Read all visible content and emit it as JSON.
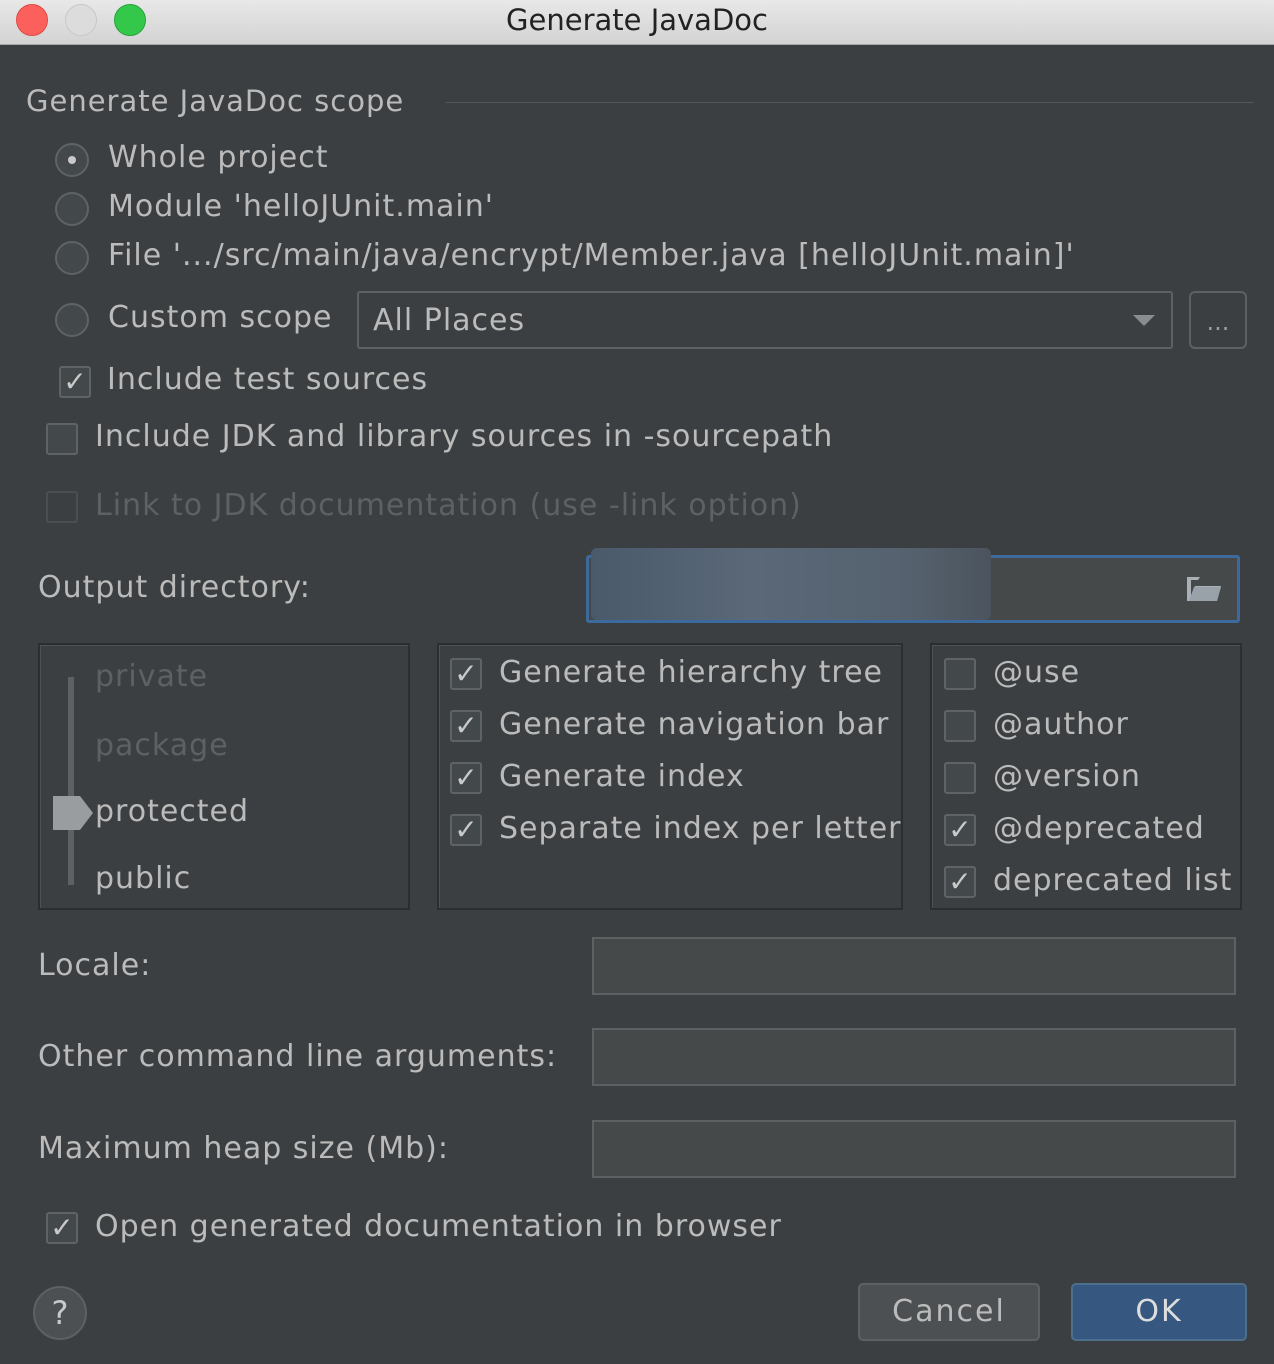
{
  "window": {
    "title": "Generate JavaDoc"
  },
  "scope": {
    "section_title": "Generate JavaDoc scope",
    "options": [
      {
        "label": "Whole project",
        "selected": true
      },
      {
        "label": "Module 'helloJUnit.main'",
        "selected": false
      },
      {
        "label": "File '.../src/main/java/encrypt/Member.java [helloJUnit.main]'",
        "selected": false
      },
      {
        "label": "Custom scope",
        "selected": false
      }
    ],
    "custom_scope_value": "All Places",
    "browse_label": "...",
    "include_test_sources": {
      "label": "Include test sources",
      "checked": true
    }
  },
  "options": {
    "include_jdk": {
      "label": "Include JDK and library sources in -sourcepath",
      "checked": false
    },
    "link_jdk": {
      "label": "Link to JDK documentation (use -link option)",
      "checked": false,
      "enabled": false
    }
  },
  "output": {
    "label": "Output directory:",
    "value": ""
  },
  "visibility": {
    "levels": [
      "private",
      "package",
      "protected",
      "public"
    ],
    "selected": "protected"
  },
  "generate": [
    {
      "label": "Generate hierarchy tree",
      "checked": true
    },
    {
      "label": "Generate navigation bar",
      "checked": true
    },
    {
      "label": "Generate index",
      "checked": true
    },
    {
      "label": "Separate index per letter",
      "checked": true
    }
  ],
  "tags": [
    {
      "label": "@use",
      "checked": false
    },
    {
      "label": "@author",
      "checked": false
    },
    {
      "label": "@version",
      "checked": false
    },
    {
      "label": "@deprecated",
      "checked": true
    },
    {
      "label": "deprecated list",
      "checked": true
    }
  ],
  "fields": {
    "locale_label": "Locale:",
    "locale_value": "",
    "args_label": "Other command line arguments:",
    "args_value": "",
    "heap_label": "Maximum heap size (Mb):",
    "heap_value": ""
  },
  "open_browser": {
    "label": "Open generated documentation in browser",
    "checked": true
  },
  "buttons": {
    "help": "?",
    "cancel": "Cancel",
    "ok": "OK"
  },
  "colors": {
    "background": "#3c3f41",
    "accent": "#365880",
    "focus_border": "#3d6a9c"
  }
}
